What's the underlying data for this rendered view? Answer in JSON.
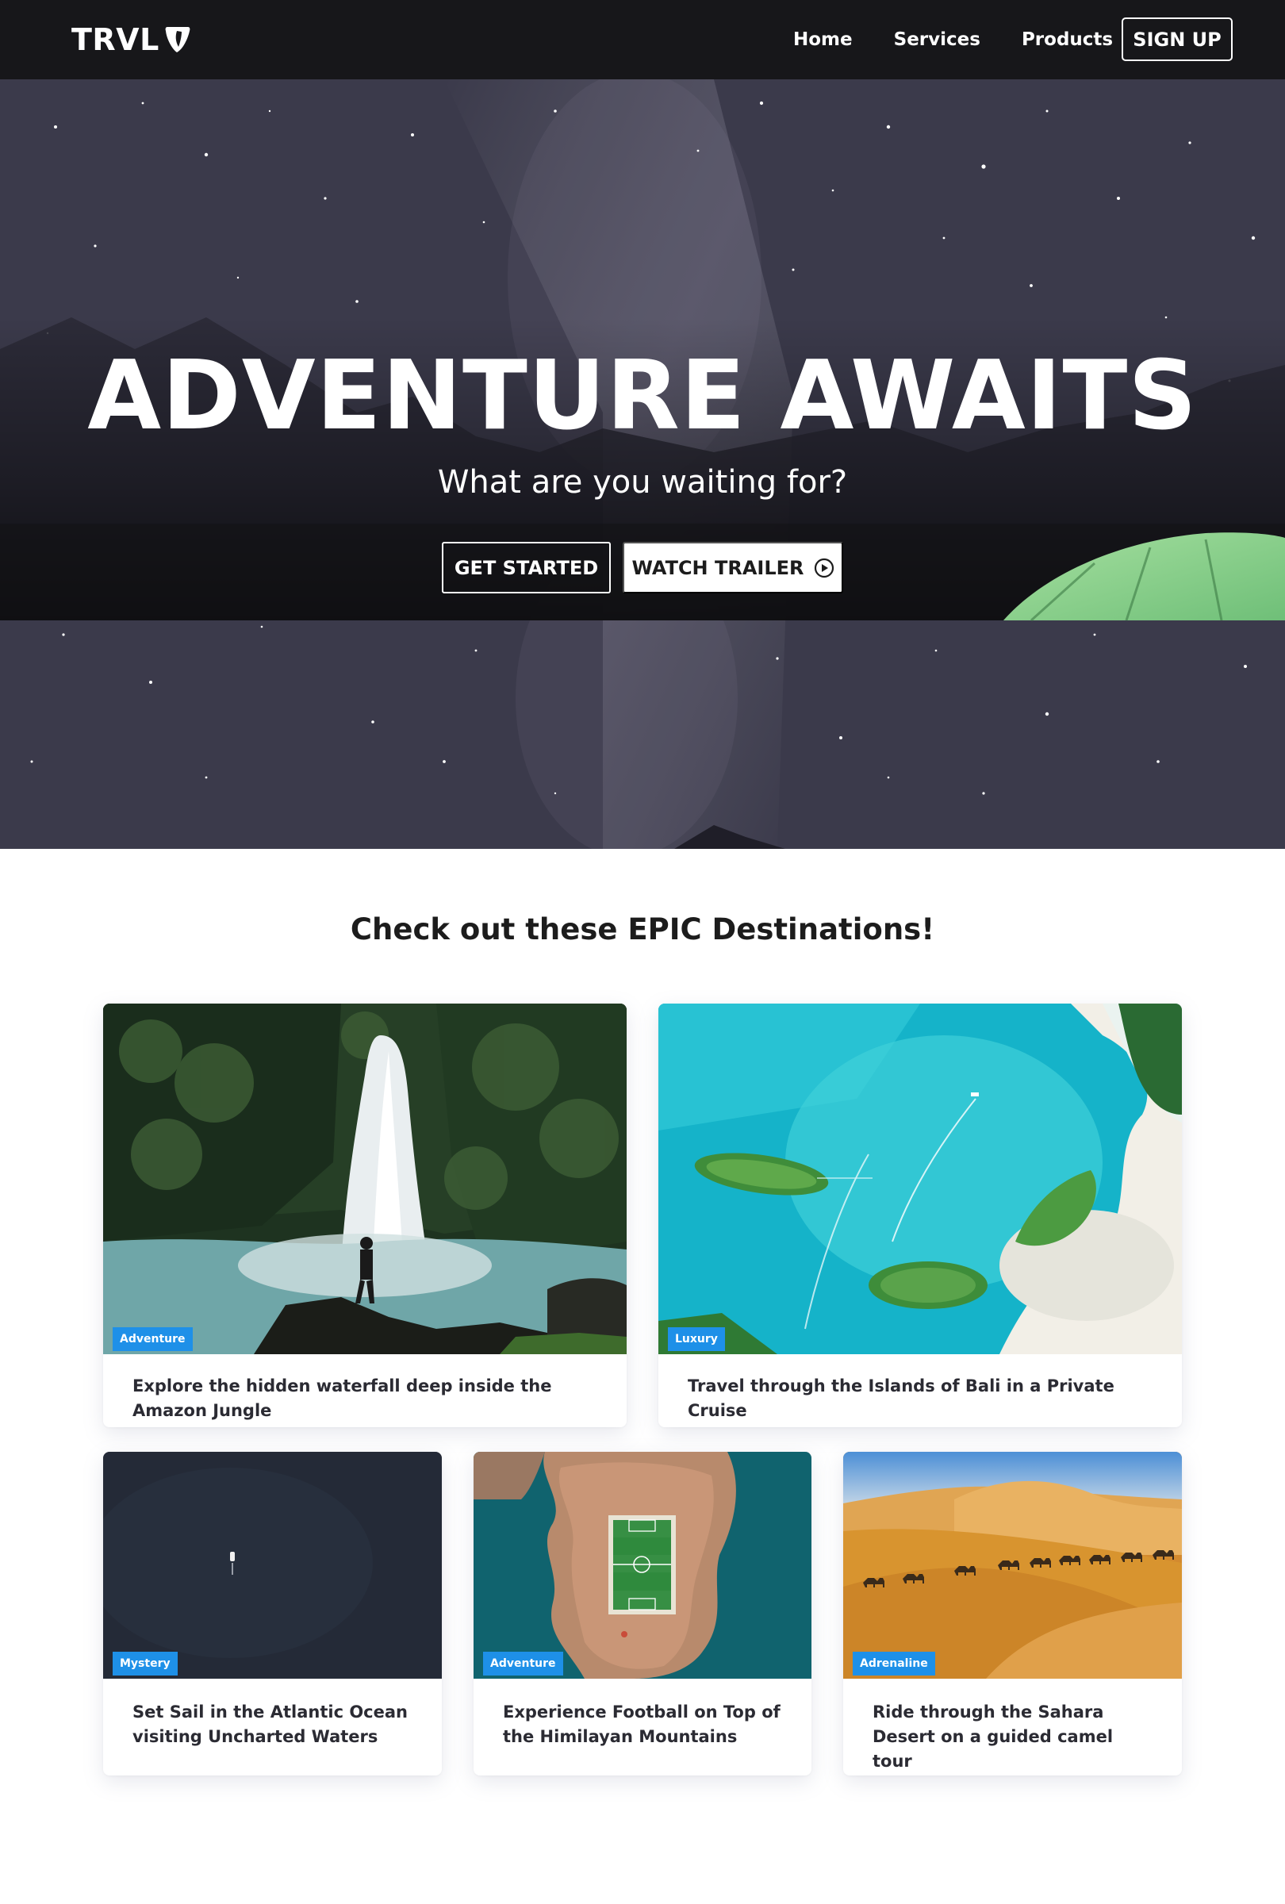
{
  "nav": {
    "logo_text": "TRVL",
    "links": [
      "Home",
      "Services",
      "Products"
    ],
    "signup_label": "SIGN UP"
  },
  "hero": {
    "title": "ADVENTURE AWAITS",
    "subtitle": "What are you waiting for?",
    "primary_button": "GET STARTED",
    "secondary_button": "WATCH TRAILER",
    "secondary_icon": "play-circle-icon"
  },
  "destinations": {
    "heading": "Check out these EPIC Destinations!",
    "cards": [
      {
        "badge": "Adventure",
        "text": "Explore the hidden waterfall deep inside the Amazon Jungle",
        "image": "waterfall"
      },
      {
        "badge": "Luxury",
        "text": "Travel through the Islands of Bali in a Private Cruise",
        "image": "islands"
      },
      {
        "badge": "Mystery",
        "text": "Set Sail in the Atlantic Ocean visiting Uncharted Waters",
        "image": "ocean"
      },
      {
        "badge": "Adventure",
        "text": "Experience Football on Top of the Himilayan Mountains",
        "image": "football"
      },
      {
        "badge": "Adrenaline",
        "text": "Ride through the Sahara Desert on a guided camel tour",
        "image": "desert"
      }
    ]
  },
  "colors": {
    "nav_bg": "#17171a",
    "badge_bg": "#1e90e8",
    "text_dark": "#1c1c1c"
  }
}
